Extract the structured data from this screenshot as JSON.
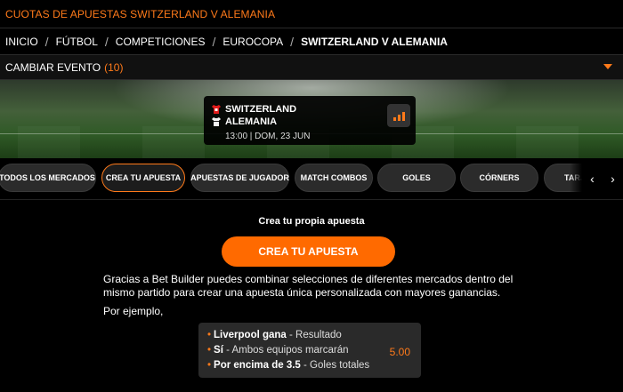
{
  "page": {
    "title": "CUOTAS DE APUESTAS SWITZERLAND V ALEMANIA"
  },
  "breadcrumb": {
    "items": [
      "INICIO",
      "FÚTBOL",
      "COMPETICIONES",
      "EUROCOPA",
      "SWITZERLAND V ALEMANIA"
    ],
    "separator": "/"
  },
  "change_event": {
    "label": "CAMBIAR EVENTO",
    "count": "(10)"
  },
  "event": {
    "home_team": "SWITZERLAND",
    "away_team": "ALEMANIA",
    "datetime": "13:00 | DOM, 23 JUN",
    "stats_icon": "bar-chart-icon"
  },
  "tabs": [
    {
      "label": "TODOS LOS MERCADOS",
      "active": false
    },
    {
      "label": "CREA TU APUESTA",
      "active": true
    },
    {
      "label": "APUESTAS DE JUGADOR",
      "active": false
    },
    {
      "label": "MATCH COMBOS",
      "active": false
    },
    {
      "label": "GOLES",
      "active": false
    },
    {
      "label": "CÓRNERS",
      "active": false
    },
    {
      "label": "TARJ",
      "active": false
    }
  ],
  "tab_nav": {
    "prev": "‹",
    "next": "›"
  },
  "content": {
    "heading": "Crea tu propia apuesta",
    "cta_label": "CREA TU APUESTA",
    "description": "Gracias a Bet Builder puedes combinar selecciones de diferentes mercados dentro del mismo partido para crear una apuesta única personalizada con mayores ganancias.",
    "example_label": "Por ejemplo,"
  },
  "example_bet": {
    "selections": [
      {
        "pick": "Liverpool gana",
        "market": " - Resultado"
      },
      {
        "pick": "Sí",
        "market": " - Ambos equipos marcarán"
      },
      {
        "pick": "Por encima de 3.5",
        "market": " - Goles totales"
      }
    ],
    "odds": "5.00"
  },
  "colors": {
    "accent": "#ff7a1a",
    "cta": "#ff6a00",
    "background": "#000000"
  }
}
